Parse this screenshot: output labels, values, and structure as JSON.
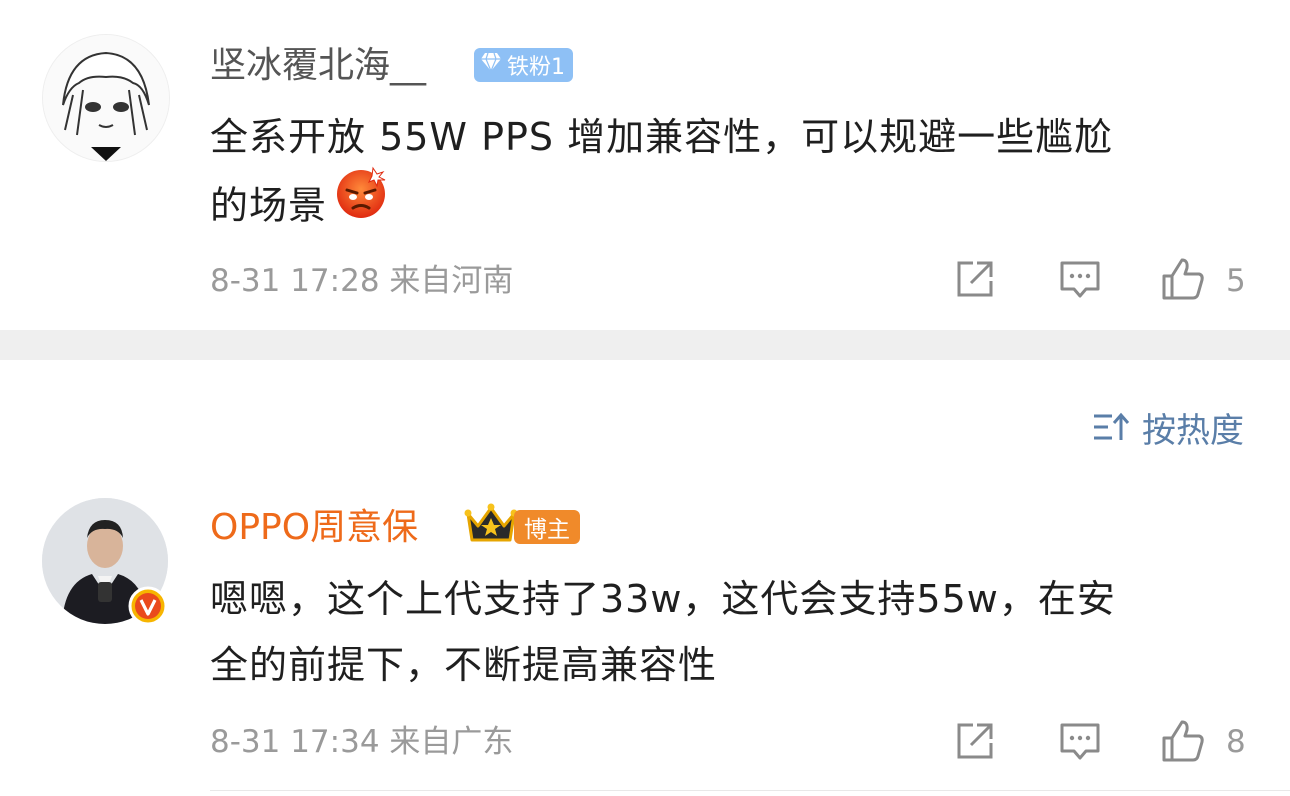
{
  "comments": [
    {
      "username": "坚冰覆北海__",
      "badge": "铁粉1",
      "text_line1": "全系开放 55W PPS 增加兼容性，可以规避一些尴尬",
      "text_line2": "的场景",
      "emoji": "angry-face",
      "meta": "8-31 17:28  来自河南",
      "likes": "5"
    },
    {
      "username": "OPPO周意保",
      "badge": "博主",
      "text_line1": "嗯嗯，这个上代支持了33w，这代会支持55w，在安",
      "text_line2": "全的前提下，不断提高兼容性",
      "meta": "8-31 17:34  来自广东",
      "likes": "8"
    }
  ],
  "sort": {
    "label": "按热度"
  },
  "colors": {
    "username_default": "#555555",
    "username_blogger": "#ee6a1a",
    "badge_fan": "#7fb6f0",
    "badge_blogger": "#f08a2a",
    "meta": "#9a9a9a",
    "sort": "#5a7ea8"
  },
  "icons": [
    "share-icon",
    "comment-icon",
    "like-icon",
    "sort-icon",
    "verified-icon",
    "crown-icon",
    "diamond-icon"
  ]
}
